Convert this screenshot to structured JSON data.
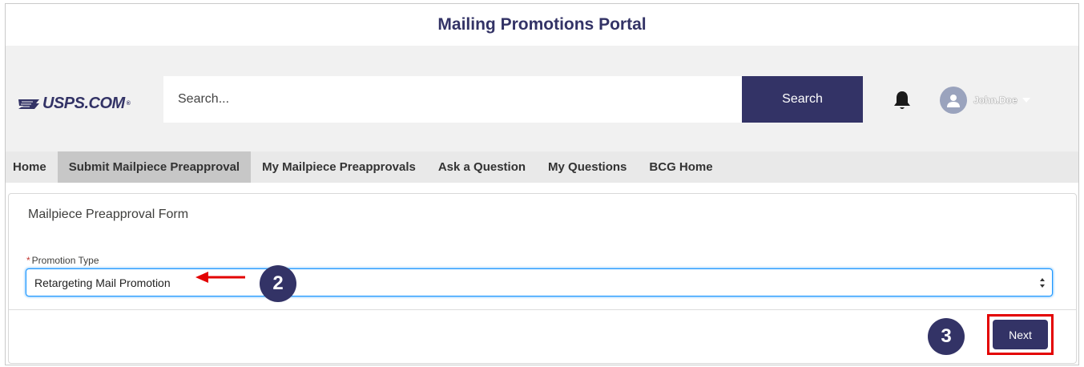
{
  "portal": {
    "title": "Mailing Promotions Portal"
  },
  "header": {
    "logo_text": "USPS.COM",
    "logo_mark": "®",
    "search_placeholder": "Search...",
    "search_label": "Search",
    "user_name": "John.Doe"
  },
  "nav": {
    "items": [
      {
        "label": "Home"
      },
      {
        "label": "Submit Mailpiece Preapproval",
        "active": true
      },
      {
        "label": "My Mailpiece Preapprovals"
      },
      {
        "label": "Ask a Question"
      },
      {
        "label": "My Questions"
      },
      {
        "label": "BCG Home"
      }
    ]
  },
  "form": {
    "title": "Mailpiece Preapproval Form",
    "required_mark": "*",
    "field_label": "Promotion Type",
    "field_value": "Retargeting Mail Promotion",
    "next_label": "Next"
  },
  "annotations": {
    "step_2": "2",
    "step_3": "3"
  },
  "colors": {
    "brand_navy": "#333366",
    "header_bg": "#f1f1f1",
    "nav_bg": "#e9e9e9",
    "nav_active_bg": "#c7c7c7",
    "focus_blue": "#1b96ff",
    "annotation_red": "#e30000",
    "required_red": "#c23934"
  },
  "icons": {
    "logo": "eagle-icon",
    "notifications": "bell-icon",
    "avatar": "user-icon",
    "user_menu": "chevron-down-icon",
    "select": "up-down-arrows-icon"
  }
}
